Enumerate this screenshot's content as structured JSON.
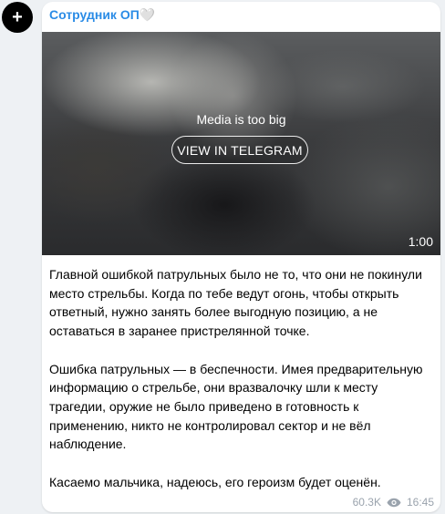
{
  "avatar": {
    "symbol": "+"
  },
  "post": {
    "author": "Сотрудник ОП🤍",
    "media": {
      "notice": "Media is too big",
      "button_label": "VIEW IN TELEGRAM",
      "duration": "1:00"
    },
    "paragraphs": [
      "Главной ошибкой патрульных было не то, что они не покинули место стрельбы. Когда по тебе ведут огонь, чтобы открыть ответный, нужно занять более выгодную позицию, а не оставаться в заранее пристрелянной точке.",
      "Ошибка патрульных — в беспечности. Имея предварительную информацию о стрельбе, они вразвалочку шли к месту трагедии, оружие не было приведено в готовность к применению, никто не контролировал сектор и не вёл наблюдение.",
      "Касаемо мальчика, надеюсь, его героизм будет оценён."
    ],
    "views": "60.3K",
    "time": "16:45"
  },
  "colors": {
    "author": "#2b8ce6",
    "meta": "#9aa3ad",
    "background": "#eef1f4"
  }
}
